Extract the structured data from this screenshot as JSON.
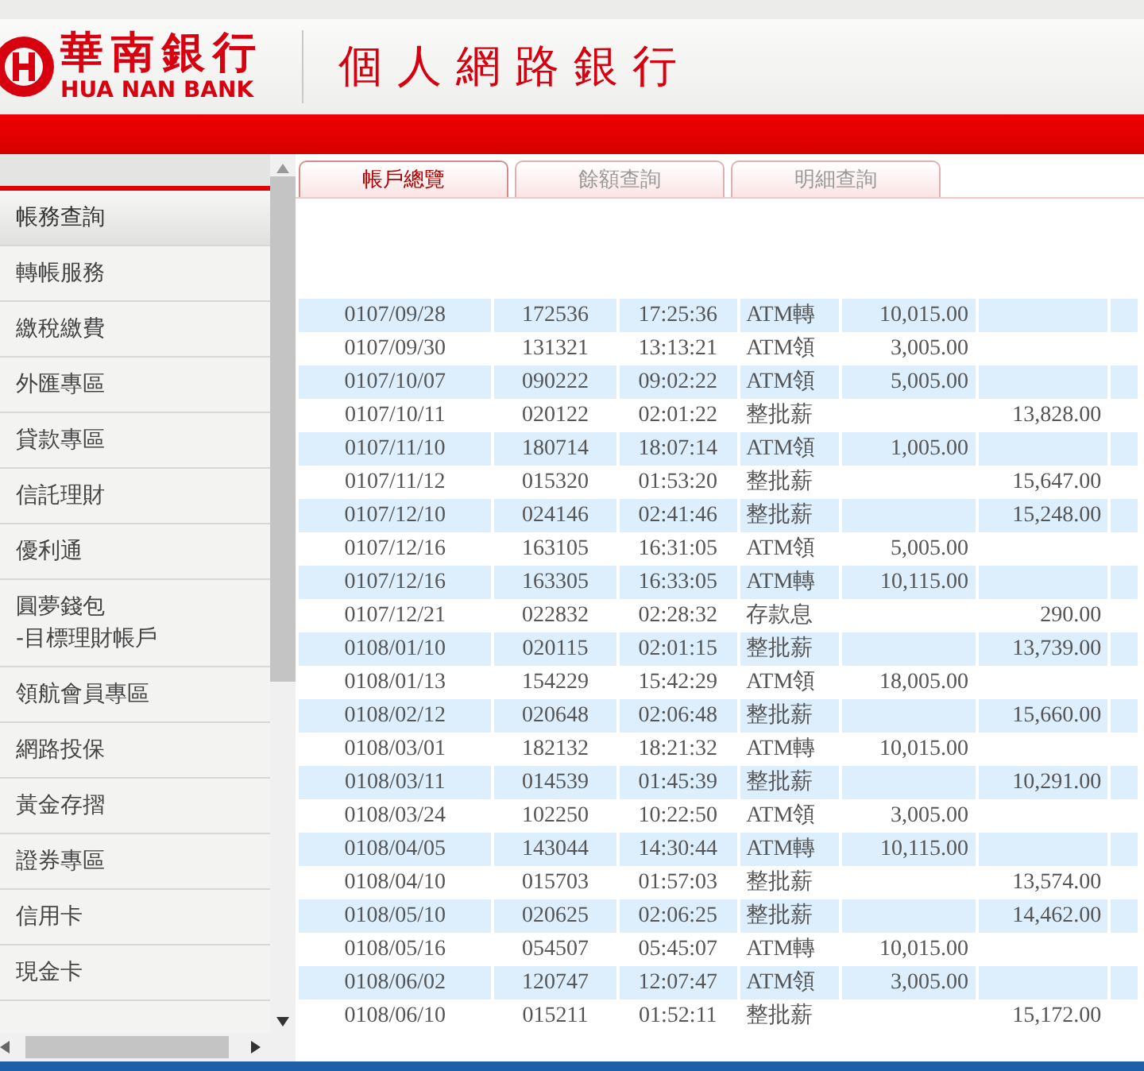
{
  "header": {
    "bank_name": "華南銀行",
    "bank_name_en": "HUA NAN BANK",
    "service_title": "個人網路銀行"
  },
  "sidebar": {
    "items": [
      {
        "label": "帳務查詢",
        "selected": true
      },
      {
        "label": "轉帳服務",
        "selected": false
      },
      {
        "label": "繳稅繳費",
        "selected": false
      },
      {
        "label": "外匯專區",
        "selected": false
      },
      {
        "label": "貸款專區",
        "selected": false
      },
      {
        "label": "信託理財",
        "selected": false
      },
      {
        "label": "優利通",
        "selected": false
      },
      {
        "label": "圓夢錢包\n-目標理財帳戶",
        "selected": false
      },
      {
        "label": "領航會員專區",
        "selected": false
      },
      {
        "label": "網路投保",
        "selected": false
      },
      {
        "label": "黃金存摺",
        "selected": false
      },
      {
        "label": "證券專區",
        "selected": false
      },
      {
        "label": "信用卡",
        "selected": false
      },
      {
        "label": "現金卡",
        "selected": false
      }
    ]
  },
  "tabs": [
    {
      "label": "帳戶總覽",
      "selected": true
    },
    {
      "label": "餘額查詢",
      "selected": false
    },
    {
      "label": "明細查詢",
      "selected": false
    }
  ],
  "table": {
    "rows": [
      [
        "0107/09/28",
        "172536",
        "17:25:36",
        "ATM轉",
        "10,015.00",
        ""
      ],
      [
        "0107/09/30",
        "131321",
        "13:13:21",
        "ATM領",
        "3,005.00",
        ""
      ],
      [
        "0107/10/07",
        "090222",
        "09:02:22",
        "ATM領",
        "5,005.00",
        ""
      ],
      [
        "0107/10/11",
        "020122",
        "02:01:22",
        "整批薪",
        "",
        "13,828.00"
      ],
      [
        "0107/11/10",
        "180714",
        "18:07:14",
        "ATM領",
        "1,005.00",
        ""
      ],
      [
        "0107/11/12",
        "015320",
        "01:53:20",
        "整批薪",
        "",
        "15,647.00"
      ],
      [
        "0107/12/10",
        "024146",
        "02:41:46",
        "整批薪",
        "",
        "15,248.00"
      ],
      [
        "0107/12/16",
        "163105",
        "16:31:05",
        "ATM領",
        "5,005.00",
        ""
      ],
      [
        "0107/12/16",
        "163305",
        "16:33:05",
        "ATM轉",
        "10,115.00",
        ""
      ],
      [
        "0107/12/21",
        "022832",
        "02:28:32",
        "存款息",
        "",
        "290.00"
      ],
      [
        "0108/01/10",
        "020115",
        "02:01:15",
        "整批薪",
        "",
        "13,739.00"
      ],
      [
        "0108/01/13",
        "154229",
        "15:42:29",
        "ATM領",
        "18,005.00",
        ""
      ],
      [
        "0108/02/12",
        "020648",
        "02:06:48",
        "整批薪",
        "",
        "15,660.00"
      ],
      [
        "0108/03/01",
        "182132",
        "18:21:32",
        "ATM轉",
        "10,015.00",
        ""
      ],
      [
        "0108/03/11",
        "014539",
        "01:45:39",
        "整批薪",
        "",
        "10,291.00"
      ],
      [
        "0108/03/24",
        "102250",
        "10:22:50",
        "ATM領",
        "3,005.00",
        ""
      ],
      [
        "0108/04/05",
        "143044",
        "14:30:44",
        "ATM轉",
        "10,115.00",
        ""
      ],
      [
        "0108/04/10",
        "015703",
        "01:57:03",
        "整批薪",
        "",
        "13,574.00"
      ],
      [
        "0108/05/10",
        "020625",
        "02:06:25",
        "整批薪",
        "",
        "14,462.00"
      ],
      [
        "0108/05/16",
        "054507",
        "05:45:07",
        "ATM轉",
        "10,015.00",
        ""
      ],
      [
        "0108/06/02",
        "120747",
        "12:07:47",
        "ATM領",
        "3,005.00",
        ""
      ],
      [
        "0108/06/10",
        "015211",
        "01:52:11",
        "整批薪",
        "",
        "15,172.00"
      ]
    ]
  }
}
